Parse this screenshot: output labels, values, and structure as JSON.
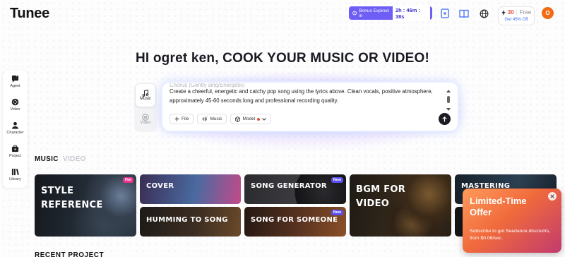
{
  "header": {
    "logo": "Tunee",
    "bonus_label": "Bonus Expired in",
    "bonus_timer": "2h : 46m : 38s",
    "credits": "30",
    "plan": "Free",
    "offer": "Get 45% Off",
    "avatar_initial": "O"
  },
  "sidebar": {
    "items": [
      {
        "label": "Agent",
        "icon": "agent-icon"
      },
      {
        "label": "Video",
        "icon": "video-icon"
      },
      {
        "label": "Character",
        "icon": "character-icon"
      },
      {
        "label": "Project",
        "icon": "project-icon"
      },
      {
        "label": "Library",
        "icon": "library-icon"
      }
    ]
  },
  "headline": "HI ogret ken, COOK YOUR MUSIC OR VIDEO!",
  "composer": {
    "modes": [
      {
        "label": "Music",
        "icon": "music-note-icon",
        "active": true
      },
      {
        "label": "Video",
        "icon": "video-icon",
        "active": false
      }
    ],
    "prompt_faded": "Chorus (Gently sing/Energetic)",
    "prompt_text": "Create a cheerful, energetic and catchy pop song using the lyrics above. Clean vocals, positive atmosphere, approximately 45-60 seconds long and professional recording quality.",
    "chips": [
      {
        "label": "File",
        "icon": "plus-icon"
      },
      {
        "label": "Music",
        "icon": "waveform-icon"
      },
      {
        "label": "Model",
        "icon": "cube-icon"
      }
    ]
  },
  "category_tabs": {
    "music": "MUSIC",
    "video": "VIDEO"
  },
  "cards": {
    "style_reference": {
      "title_line1": "STYLE",
      "title_line2": "REFERENCE",
      "badge": "Hot"
    },
    "cover": {
      "title": "COVER"
    },
    "humming": {
      "title": "HUMMING TO SONG"
    },
    "song_generator": {
      "title": "SONG GENERATOR",
      "badge": "New"
    },
    "song_for_someone": {
      "title": "SONG FOR SOMEONE",
      "badge": "New"
    },
    "bgm": {
      "title_line1": "BGM FOR",
      "title_line2": "VIDEO"
    },
    "mastering": {
      "title": "MASTERING"
    }
  },
  "recent_heading": "RECENT PROJECT",
  "promo": {
    "title": "Limited-Time Offer",
    "description": "Subscribe to get Seedance discounts, from $0.06/sec."
  },
  "colors": {
    "accent": "#6e5ef5",
    "avatar": "#f06b14",
    "hot": "#e8338f",
    "new": "#5a4ff0",
    "promo": "#f06a3c"
  }
}
